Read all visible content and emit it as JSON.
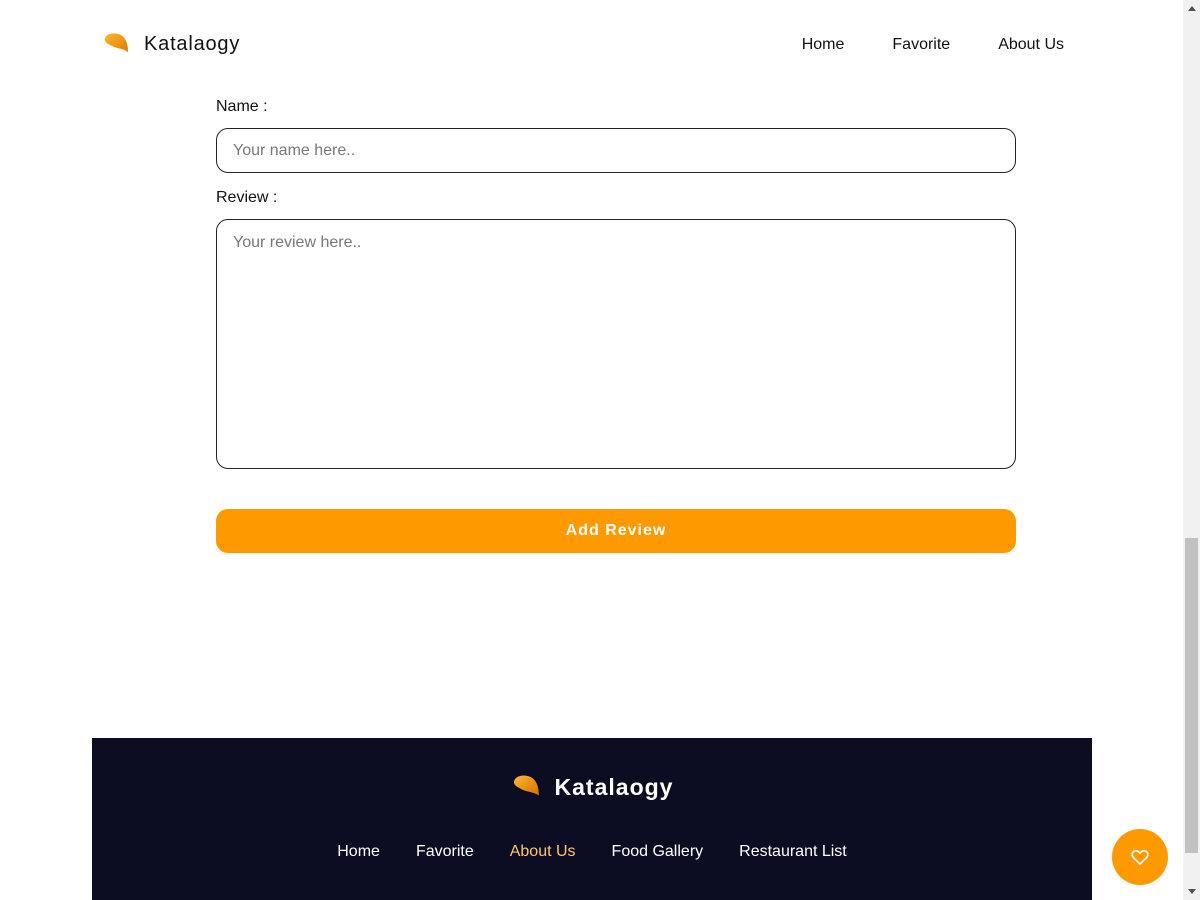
{
  "header": {
    "brand": "Katalaogy",
    "nav": [
      "Home",
      "Favorite",
      "About Us"
    ]
  },
  "form": {
    "name_label": "Name :",
    "name_placeholder": "Your name here..",
    "review_label": "Review :",
    "review_placeholder": "Your review here..",
    "submit_label": "Add Review"
  },
  "footer": {
    "brand": "Katalaogy",
    "nav": [
      "Home",
      "Favorite",
      "About Us",
      "Food Gallery",
      "Restaurant List"
    ],
    "active_item": "About Us"
  },
  "fab": {
    "icon": "heart-icon"
  },
  "colors": {
    "accent": "#ff9900",
    "footer_bg": "#0c0d22",
    "footer_active": "#ffc577"
  }
}
